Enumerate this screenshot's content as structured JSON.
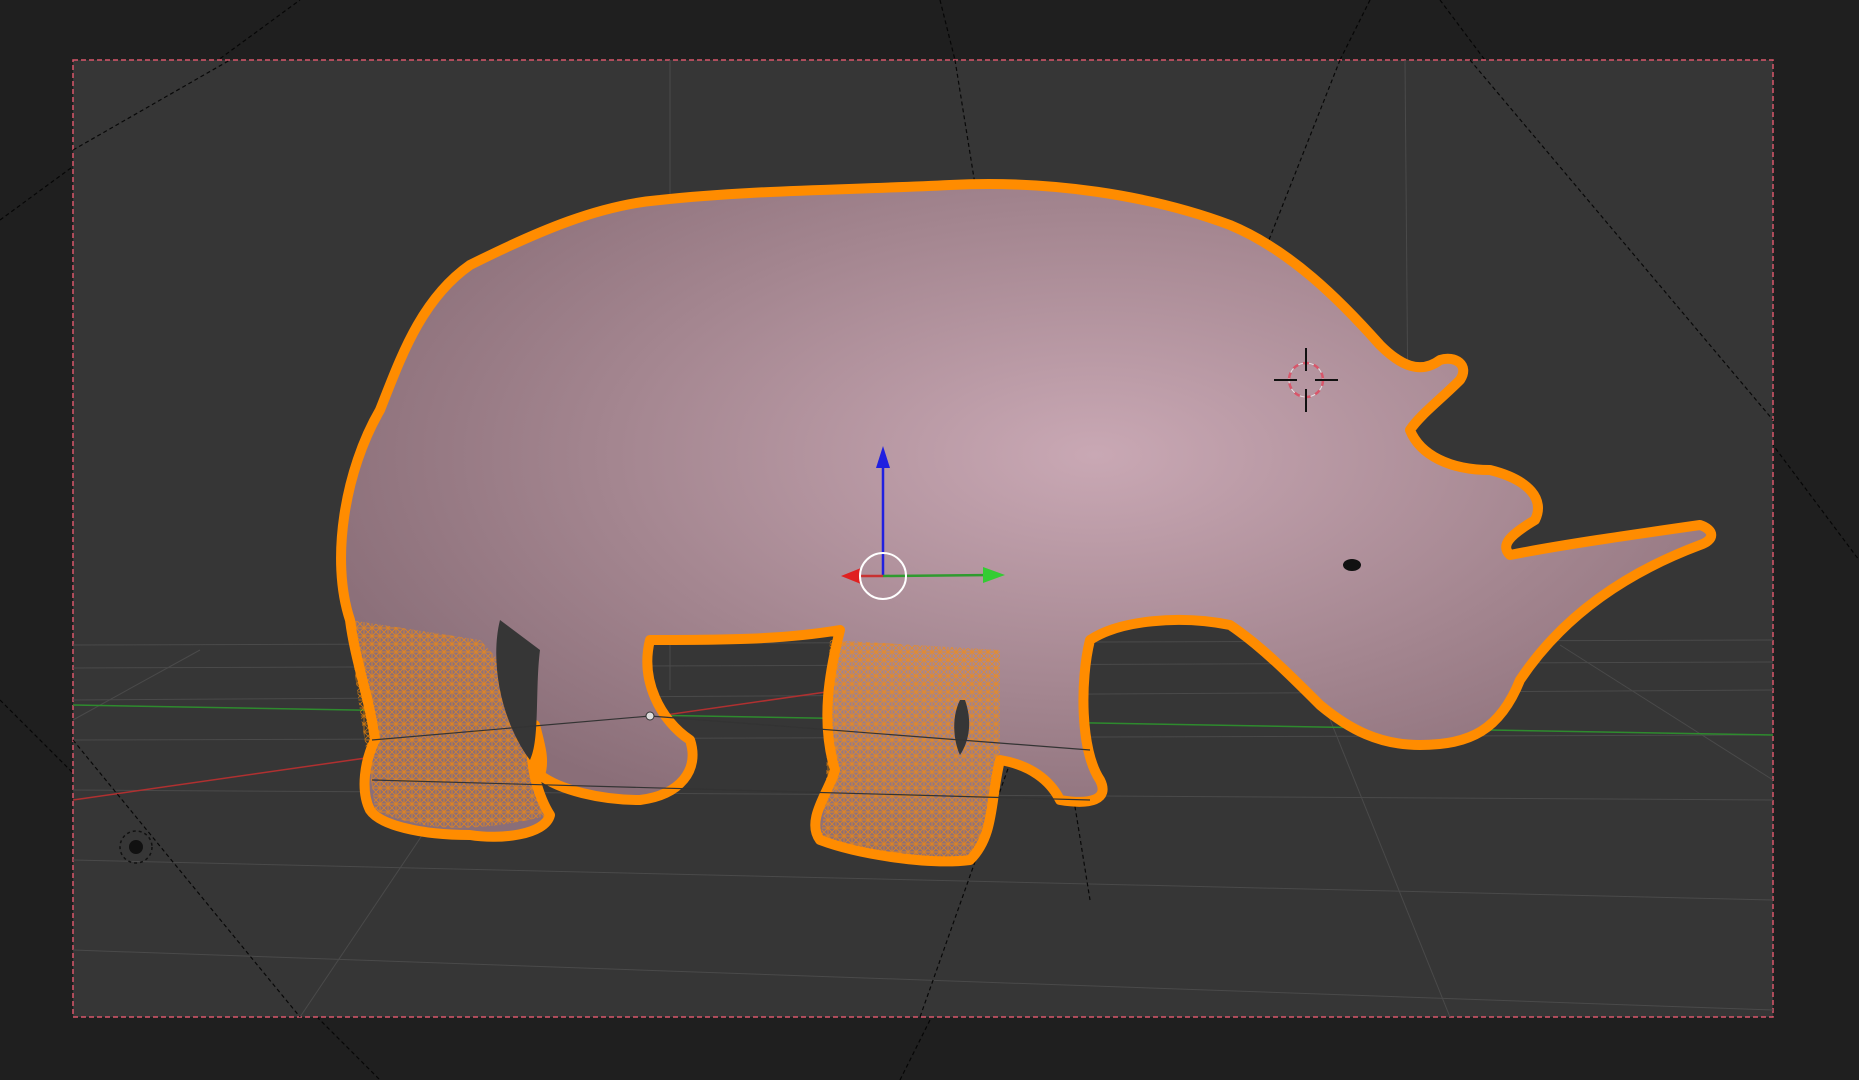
{
  "viewport": {
    "mode": "edit",
    "display": "wireframe-overlay",
    "selected_object": "rhino-mesh",
    "colors": {
      "outer_background": "#1f1f1f",
      "camera_frame_fill": "#353535",
      "camera_frame_border": "#d8566a",
      "selection_orange": "#ff8c00",
      "mesh_surface": "#a88c96",
      "x_axis": "#c83232",
      "y_axis": "#2e8b2e",
      "z_axis": "#2020e0",
      "grid_line": "#4a4a4a"
    },
    "icons": [
      "3d-cursor-icon",
      "transform-gizmo-icon",
      "light-icon"
    ]
  }
}
